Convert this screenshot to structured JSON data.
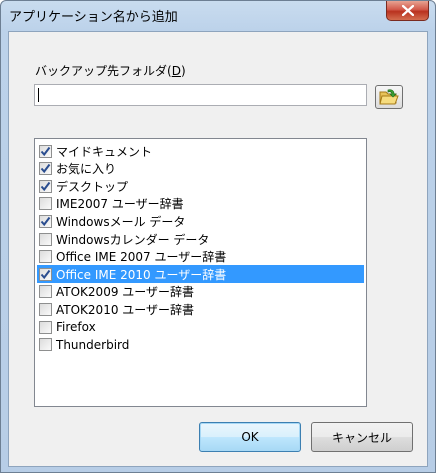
{
  "window": {
    "title": "アプリケーション名から追加"
  },
  "folder": {
    "label": "バックアップ先フォルダ(",
    "mnemonic": "D",
    "label_end": ")",
    "value": ""
  },
  "items": [
    {
      "label": "マイドキュメント",
      "checked": true,
      "selected": false
    },
    {
      "label": "お気に入り",
      "checked": true,
      "selected": false
    },
    {
      "label": "デスクトップ",
      "checked": true,
      "selected": false
    },
    {
      "label": "IME2007 ユーザー辞書",
      "checked": false,
      "selected": false
    },
    {
      "label": "Windowsメール データ",
      "checked": true,
      "selected": false
    },
    {
      "label": "Windowsカレンダー データ",
      "checked": false,
      "selected": false
    },
    {
      "label": "Office IME 2007 ユーザー辞書",
      "checked": false,
      "selected": false
    },
    {
      "label": "Office IME 2010 ユーザー辞書",
      "checked": true,
      "selected": true
    },
    {
      "label": "ATOK2009 ユーザー辞書",
      "checked": false,
      "selected": false
    },
    {
      "label": "ATOK2010 ユーザー辞書",
      "checked": false,
      "selected": false
    },
    {
      "label": "Firefox",
      "checked": false,
      "selected": false
    },
    {
      "label": "Thunderbird",
      "checked": false,
      "selected": false
    }
  ],
  "buttons": {
    "ok": "OK",
    "cancel": "キャンセル"
  },
  "colors": {
    "selection": "#3399ff",
    "checkmark": "#2a4d8f"
  }
}
